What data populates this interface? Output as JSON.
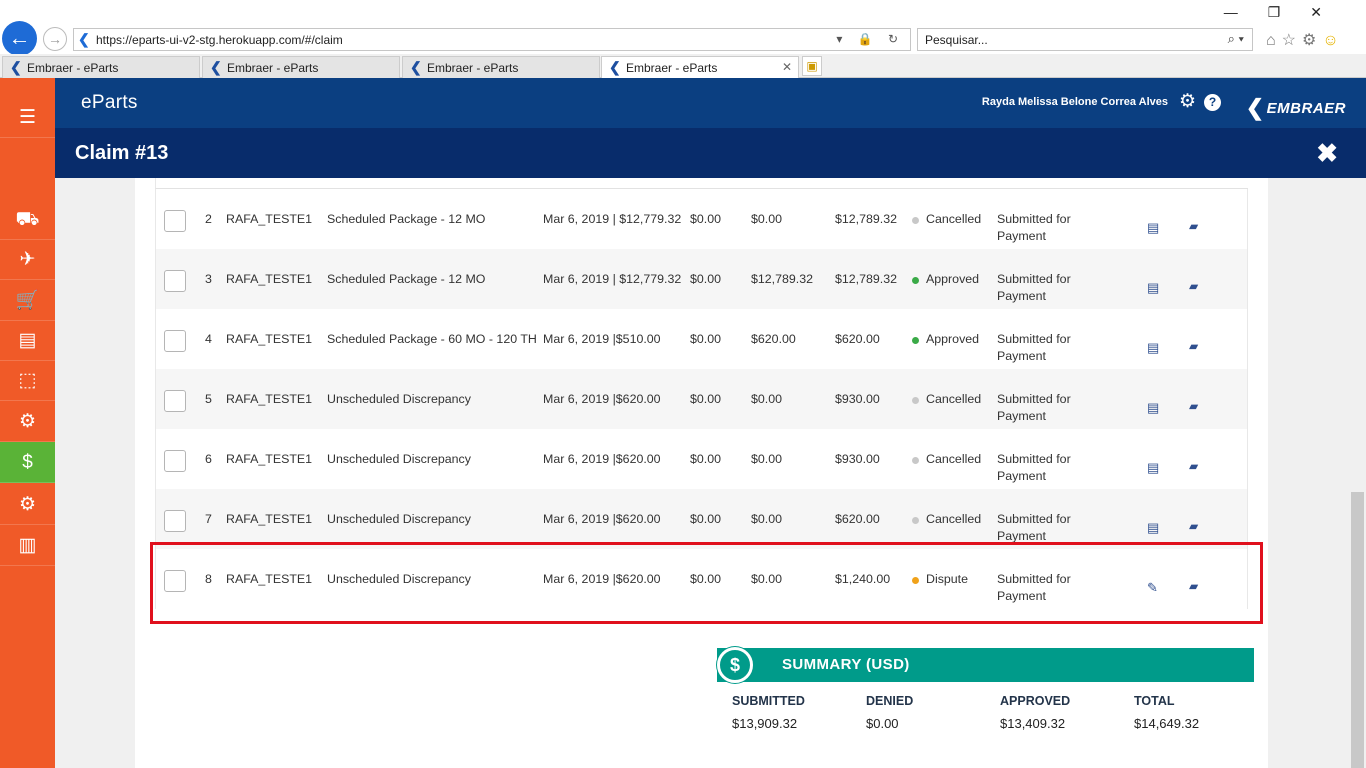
{
  "browser": {
    "url": "https://eparts-ui-v2-stg.herokuapp.com/#/claim",
    "search_placeholder": "Pesquisar...",
    "tabs": [
      {
        "label": "Embraer - eParts"
      },
      {
        "label": "Embraer - eParts"
      },
      {
        "label": "Embraer - eParts"
      },
      {
        "label": "Embraer - eParts"
      }
    ]
  },
  "header": {
    "app_name": "eParts",
    "user_name": "Rayda Melissa Belone Correa Alves",
    "brand": "EMBRAER"
  },
  "claim": {
    "title": "Claim #13",
    "close_glyph": "✖"
  },
  "sidebar": {
    "items": [
      {
        "icon": "menu-icon",
        "glyph": "☰"
      },
      {
        "icon": "truck-icon",
        "glyph": "⛟"
      },
      {
        "icon": "plane-icon",
        "glyph": "✈"
      },
      {
        "icon": "cart-icon",
        "glyph": "🛒"
      },
      {
        "icon": "document-icon",
        "glyph": "▤"
      },
      {
        "icon": "box-icon",
        "glyph": "⬚"
      },
      {
        "icon": "settings-gear-icon",
        "glyph": "⚙"
      },
      {
        "icon": "dollar-icon",
        "glyph": "$"
      },
      {
        "icon": "gears-icon",
        "glyph": "⚙"
      },
      {
        "icon": "chart-icon",
        "glyph": "▥"
      }
    ],
    "active_index": 7
  },
  "status_colors": {
    "Cancelled": "#c8c8c8",
    "Approved": "#3aaa47",
    "Dispute": "#f0a21a"
  },
  "rows": [
    {
      "num": "2",
      "user": "RAFA_TESTE1",
      "desc": "Scheduled Package - 12 MO",
      "date": "Mar 6, 2019 | $12,779.32",
      "submitted": "$0.00",
      "denied": "$0.00",
      "total": "$12,789.32",
      "status": "Cancelled",
      "payment": "Submitted for Payment",
      "action_icon": "invoice-icon"
    },
    {
      "num": "3",
      "user": "RAFA_TESTE1",
      "desc": "Scheduled Package - 12 MO",
      "date": "Mar 6, 2019 | $12,779.32",
      "submitted": "$0.00",
      "denied": "$12,789.32",
      "total": "$12,789.32",
      "status": "Approved",
      "payment": "Submitted for Payment",
      "action_icon": "invoice-icon"
    },
    {
      "num": "4",
      "user": "RAFA_TESTE1",
      "desc": "Scheduled Package - 60 MO - 120 TH",
      "date": "Mar 6, 2019 |$510.00",
      "submitted": "$0.00",
      "denied": "$620.00",
      "total": "$620.00",
      "status": "Approved",
      "payment": "Submitted for Payment",
      "action_icon": "invoice-icon"
    },
    {
      "num": "5",
      "user": "RAFA_TESTE1",
      "desc": "Unscheduled Discrepancy",
      "date": "Mar 6, 2019 |$620.00",
      "submitted": "$0.00",
      "denied": "$0.00",
      "total": "$930.00",
      "status": "Cancelled",
      "payment": "Submitted for Payment",
      "action_icon": "invoice-icon"
    },
    {
      "num": "6",
      "user": "RAFA_TESTE1",
      "desc": "Unscheduled Discrepancy",
      "date": "Mar 6, 2019 |$620.00",
      "submitted": "$0.00",
      "denied": "$0.00",
      "total": "$930.00",
      "status": "Cancelled",
      "payment": "Submitted for Payment",
      "action_icon": "invoice-icon"
    },
    {
      "num": "7",
      "user": "RAFA_TESTE1",
      "desc": "Unscheduled Discrepancy",
      "date": "Mar 6, 2019 |$620.00",
      "submitted": "$0.00",
      "denied": "$0.00",
      "total": "$620.00",
      "status": "Cancelled",
      "payment": "Submitted for Payment",
      "action_icon": "invoice-icon"
    },
    {
      "num": "8",
      "user": "RAFA_TESTE1",
      "desc": "Unscheduled Discrepancy",
      "date": "Mar 6, 2019 |$620.00",
      "submitted": "$0.00",
      "denied": "$0.00",
      "total": "$1,240.00",
      "status": "Dispute",
      "payment": "Submitted for Payment",
      "action_icon": "pencil-icon"
    }
  ],
  "summary": {
    "icon": "$",
    "title": "SUMMARY (USD)",
    "submitted_label": "SUBMITTED",
    "submitted_value": "$13,909.32",
    "denied_label": "DENIED",
    "denied_value": "$0.00",
    "approved_label": "APPROVED",
    "approved_value": "$13,409.32",
    "total_label": "TOTAL",
    "total_value": "$14,649.32"
  }
}
